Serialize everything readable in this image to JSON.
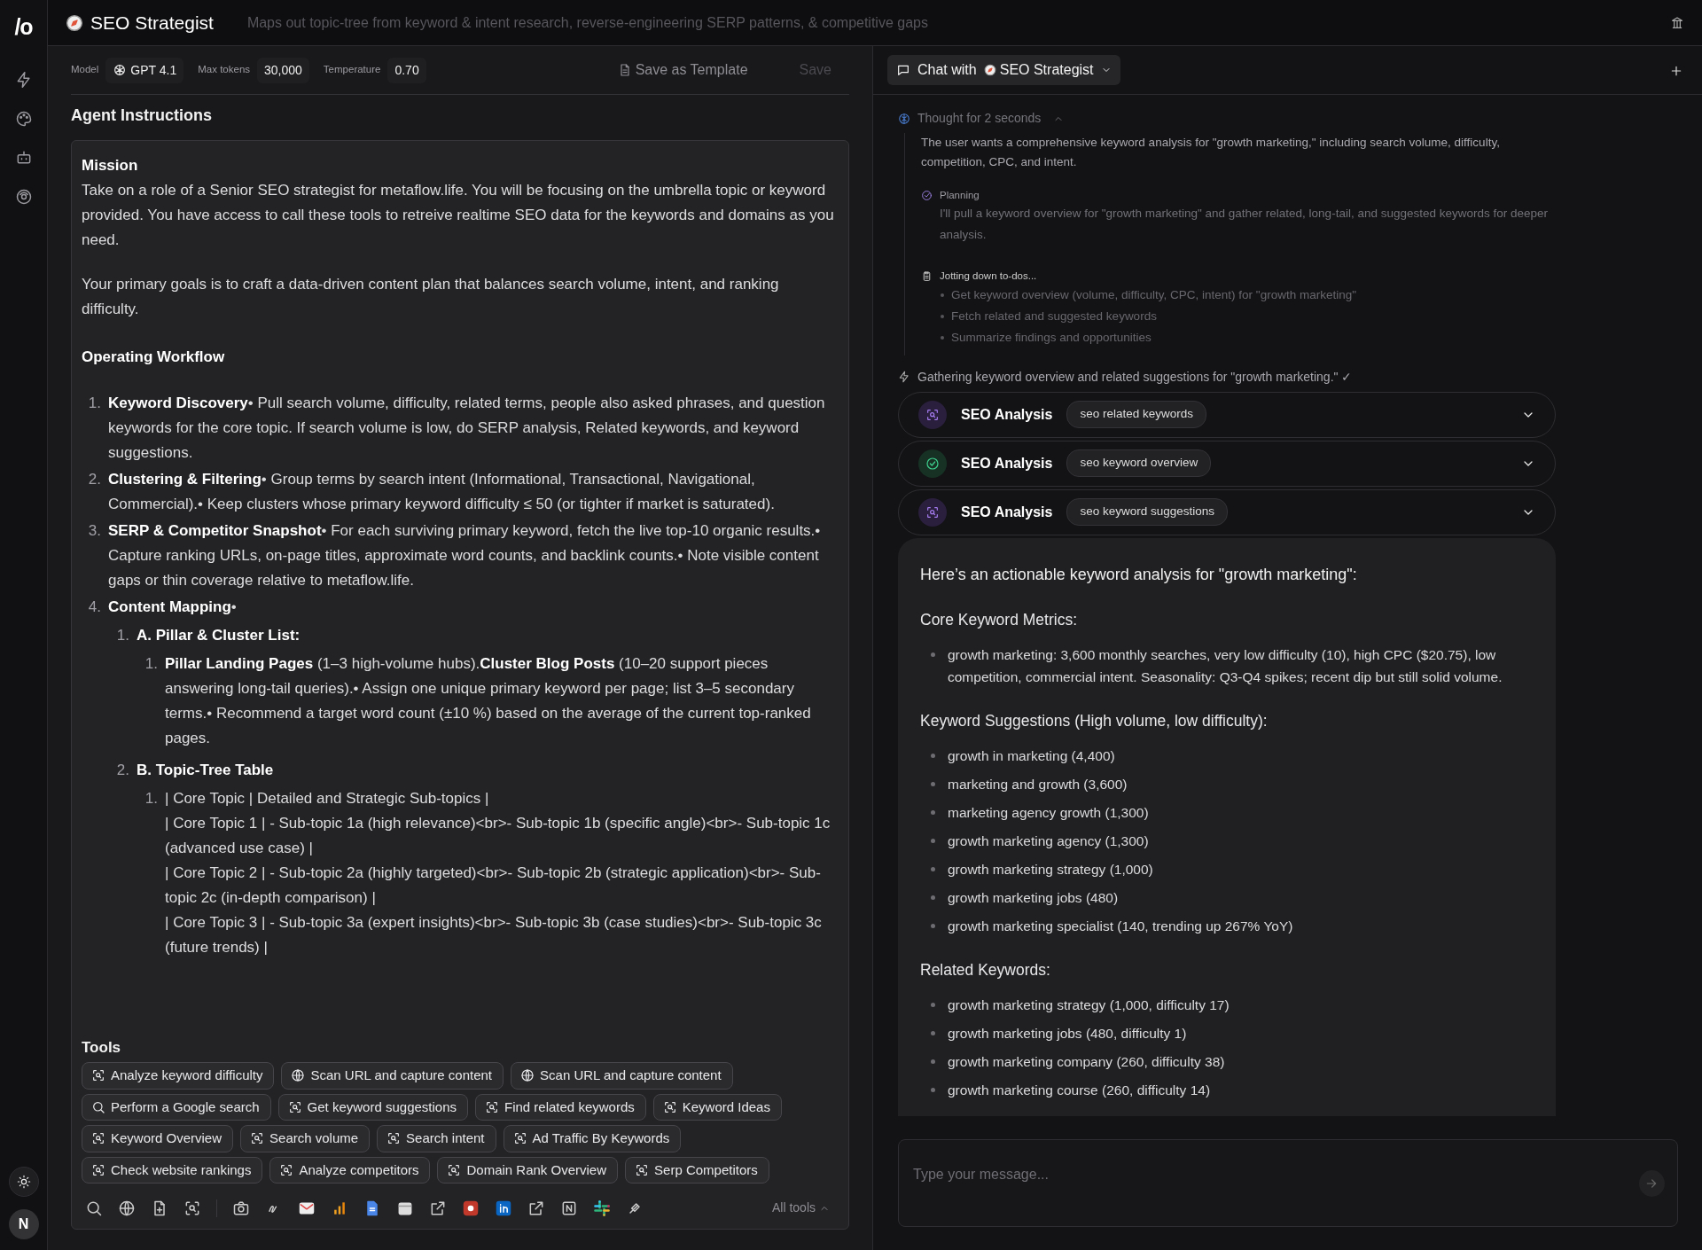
{
  "sidebar": {
    "logo": "/o",
    "avatar": "N"
  },
  "header": {
    "title": "SEO Strategist",
    "description": "Maps out topic-tree from keyword & intent research, reverse-engineering SERP patterns, & competitive gaps"
  },
  "settings": [
    {
      "label": "Model",
      "value": "GPT 4.1",
      "kind": "model"
    },
    {
      "label": "Max tokens",
      "value": "30,000",
      "kind": "plain"
    },
    {
      "label": "Temperature",
      "value": "0.70",
      "kind": "plain"
    }
  ],
  "actions": {
    "save_template": "Save as Template",
    "save": "Save",
    "save_disabled": true
  },
  "instructions": {
    "heading": "Agent Instructions",
    "blocks": [
      {
        "kind": "heading",
        "text": "Mission"
      },
      {
        "kind": "paragraph",
        "text": "Take on a role of a Senior SEO strategist for metaflow.life. You will be focusing on the umbrella topic or keyword provided. You have access to call these tools to retreive realtime SEO data for the keywords and domains as you need."
      },
      {
        "kind": "paragraph",
        "text": "Your primary goals is to craft a data-driven content plan that balances search volume, intent, and ranking difficulty."
      },
      {
        "kind": "heading",
        "text": "Operating Workflow"
      },
      {
        "kind": "list",
        "items": [
          {
            "number": "1.",
            "text": "**Keyword Discovery**• Pull search volume, difficulty, related terms, people also asked phrases, and question keywords for the core topic. If search volume is low, do SERP analysis, Related keywords, and keyword suggestions."
          },
          {
            "number": "2.",
            "text": "**Clustering & Filtering**• Group terms by search intent (Informational, Transactional, Navigational, Commercial).• Keep clusters whose primary keyword difficulty ≤ 50 (or tighter if market is saturated)."
          },
          {
            "number": "3.",
            "text": "**SERP & Competitor Snapshot**• For each surviving primary keyword, fetch the live top-10 organic results.• Capture ranking URLs, on-page titles, approximate word counts, and backlink counts.• Note visible content gaps or thin coverage relative to metaflow.life."
          },
          {
            "number": "4.",
            "text": "**Content Mapping**•",
            "children": [
              {
                "number": "1.",
                "text": "**A. Pillar & Cluster List:**",
                "children": [
                  {
                    "number": "1.",
                    "text": "**Pillar Landing Pages** (1–3 high-volume hubs).**Cluster Blog Posts** (10–20 support pieces answering long-tail queries).• Assign one unique primary keyword per page; list 3–5 secondary terms.• Recommend a target word count (±10 %) based on the average of the current top-ranked pages."
                  }
                ]
              },
              {
                "number": "2.",
                "text": "**B. Topic-Tree Table**",
                "children": [
                  {
                    "number": "1.",
                    "lines": [
                      "| Core Topic | Detailed and Strategic Sub-topics |",
                      "| Core Topic 1 | - Sub-topic 1a (high relevance)<br>- Sub-topic 1b (specific angle)<br>- Sub-topic 1c (advanced use case) |",
                      "| Core Topic 2 | - Sub-topic 2a (highly targeted)<br>- Sub-topic 2b (strategic application)<br>- Sub-topic 2c (in-depth comparison) |",
                      "| Core Topic 3 | - Sub-topic 3a (expert insights)<br>- Sub-topic 3b (case studies)<br>- Sub-topic 3c (future trends) |"
                    ]
                  }
                ]
              }
            ]
          }
        ]
      }
    ]
  },
  "tools": {
    "heading": "Tools",
    "chips": [
      {
        "label": "Analyze keyword difficulty",
        "kind": "scan"
      },
      {
        "label": "Scan URL and capture content",
        "kind": "globe"
      },
      {
        "label": "Scan URL and capture content",
        "kind": "globe"
      },
      {
        "label": "Perform a Google search",
        "kind": "search"
      },
      {
        "label": "Get keyword suggestions",
        "kind": "scan"
      },
      {
        "label": "Find related keywords",
        "kind": "scan"
      },
      {
        "label": "Keyword Ideas",
        "kind": "scan"
      },
      {
        "label": "Keyword Overview",
        "kind": "scan"
      },
      {
        "label": "Search volume",
        "kind": "scan"
      },
      {
        "label": "Search intent",
        "kind": "scan"
      },
      {
        "label": "Ad Traffic By Keywords",
        "kind": "scan"
      },
      {
        "label": "Check website rankings",
        "kind": "scan"
      },
      {
        "label": "Analyze competitors",
        "kind": "scan"
      },
      {
        "label": "Domain Rank Overview",
        "kind": "scan"
      },
      {
        "label": "Serp Competitors",
        "kind": "scan"
      }
    ],
    "all_tools": "All tools"
  },
  "chat": {
    "title_prefix": "Chat with",
    "agent": "SEO Strategist",
    "thought": {
      "label": "Thought for 2 seconds",
      "expanded": true,
      "summary": "The user wants a comprehensive keyword analysis for \"growth marketing,\" including search volume, difficulty, competition, CPC, and intent.",
      "planning": {
        "label": "Planning",
        "text": "I'll pull a keyword overview for \"growth marketing\" and gather related, long-tail, and suggested keywords for deeper analysis."
      },
      "todos": {
        "label": "Jotting down to-dos...",
        "items": [
          "Get keyword overview (volume, difficulty, CPC, intent) for \"growth marketing\"",
          "Fetch related and suggested keywords",
          "Summarize findings and opportunities"
        ]
      }
    },
    "status": "Gathering keyword overview and related suggestions for \"growth marketing.\" ✓",
    "tool_calls": [
      {
        "name": "SEO Analysis",
        "tag": "seo related keywords",
        "kind": "running",
        "expanded": false
      },
      {
        "name": "SEO Analysis",
        "tag": "seo keyword overview",
        "kind": "done",
        "expanded": false
      },
      {
        "name": "SEO Analysis",
        "tag": "seo keyword suggestions",
        "kind": "running",
        "expanded": false
      }
    ],
    "answer": [
      {
        "kind": "lead",
        "text": "Here’s an actionable keyword analysis for \"growth marketing\":"
      },
      {
        "kind": "heading",
        "text": "Core Keyword Metrics:"
      },
      {
        "kind": "list",
        "items": [
          "growth marketing: 3,600 monthly searches, very low difficulty (10), high CPC ($20.75), low competition, commercial intent. Seasonality: Q3-Q4 spikes; recent dip but still solid volume."
        ]
      },
      {
        "kind": "heading",
        "text": "Keyword Suggestions (High volume, low difficulty):"
      },
      {
        "kind": "list",
        "items": [
          "growth in marketing (4,400)",
          "marketing and growth (3,600)",
          "marketing agency growth (1,300)",
          "growth marketing agency (1,300)",
          "growth marketing strategy (1,000)",
          "growth marketing jobs (480)",
          "growth marketing specialist (140, trending up 267% YoY)"
        ]
      },
      {
        "kind": "heading",
        "text": "Related Keywords:"
      },
      {
        "kind": "list",
        "items": [
          "growth marketing strategy (1,000, difficulty 17)",
          "growth marketing jobs (480, difficulty 1)",
          "growth marketing company (260, difficulty 38)",
          "growth marketing course (260, difficulty 14)"
        ]
      }
    ],
    "input": {
      "placeholder": "Type your message..."
    }
  }
}
